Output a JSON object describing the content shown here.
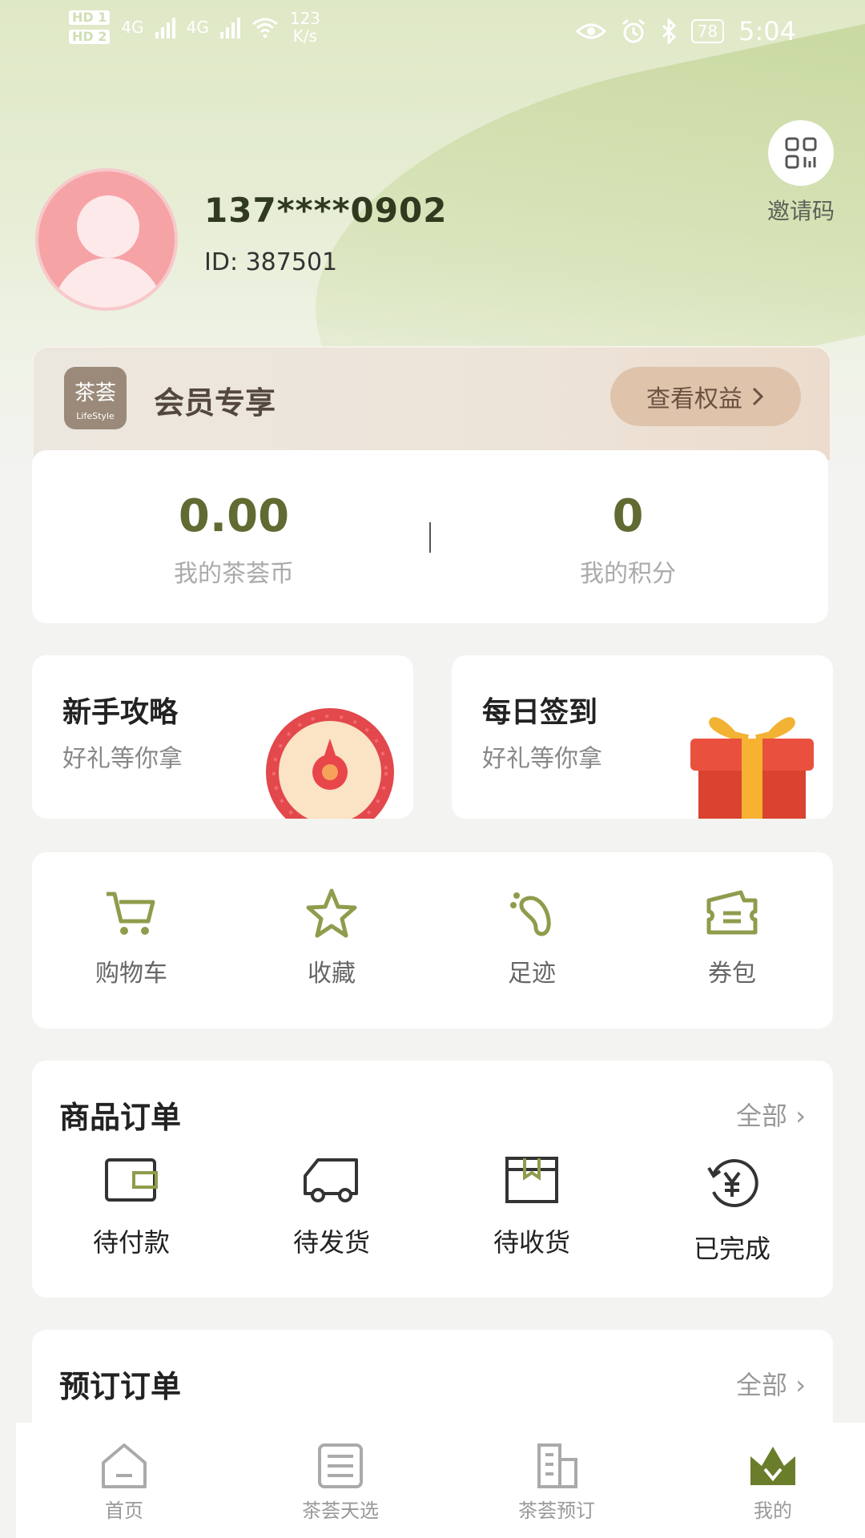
{
  "status_bar": {
    "hd1": "HD 1",
    "hd2": "HD 2",
    "sig1": "4G",
    "sig2": "4G",
    "speed_value": "123",
    "speed_unit": "K/s",
    "battery": "78",
    "time": "5:04"
  },
  "profile": {
    "phone": "137****0902",
    "id_text": "ID:  387501",
    "invite_label": "邀请码"
  },
  "member": {
    "logo_cn": "茶荟",
    "logo_en": "LifeStyle",
    "title": "会员专享",
    "button_label": "查看权益"
  },
  "stats": {
    "coins_value": "0.00",
    "coins_label": "我的茶荟币",
    "points_value": "0",
    "points_label": "我的积分"
  },
  "promos": [
    {
      "title": "新手攻略",
      "subtitle": "好礼等你拿"
    },
    {
      "title": "每日签到",
      "subtitle": "好礼等你拿"
    }
  ],
  "quick_actions": [
    {
      "label": "购物车",
      "icon": "cart-icon"
    },
    {
      "label": "收藏",
      "icon": "star-icon"
    },
    {
      "label": "足迹",
      "icon": "footprint-icon"
    },
    {
      "label": "券包",
      "icon": "coupon-icon"
    }
  ],
  "product_orders": {
    "title": "商品订单",
    "all_label": "全部",
    "items": [
      {
        "label": "待付款",
        "icon": "wallet-icon"
      },
      {
        "label": "待发货",
        "icon": "truck-icon"
      },
      {
        "label": "待收货",
        "icon": "package-icon"
      },
      {
        "label": "已完成",
        "icon": "yen-refresh-icon"
      }
    ]
  },
  "reservation_orders": {
    "title": "预订订单",
    "all_label": "全部"
  },
  "bottom_nav": [
    {
      "label": "首页",
      "icon": "home-icon"
    },
    {
      "label": "茶荟天选",
      "icon": "list-icon"
    },
    {
      "label": "茶荟预订",
      "icon": "building-icon"
    },
    {
      "label": "我的",
      "icon": "crown-icon"
    }
  ],
  "colors": {
    "accent": "#5f6b31",
    "icon_green": "#8f9c4c",
    "member_button": "#dfc3ab"
  }
}
